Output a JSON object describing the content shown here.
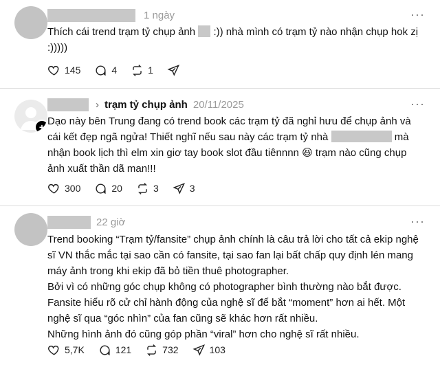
{
  "posts": [
    {
      "time": "1 ngày",
      "text_before": "Thích cái trend trạm tỷ chụp ảnh",
      "text_after": ":)) nhà mình có trạm tỷ nào nhận chụp hok zị :)))))",
      "likes": "145",
      "comments": "4",
      "reposts": "1",
      "shares": ""
    },
    {
      "group": "trạm tỷ chụp ảnh",
      "time": "20/11/2025",
      "text_before": "Dạo này bên Trung đang có trend book các trạm tỷ đã nghỉ hưu để chụp ảnh và cái kết đẹp ngã ngửa! Thiết nghĩ nếu sau này các trạm tỷ nhà",
      "text_after": "mà nhận book lịch thì elm xin giơ tay book slot đầu tiênnnn 😆 trạm nào cũng chụp ảnh xuất thần dã man!!!",
      "likes": "300",
      "comments": "20",
      "reposts": "3",
      "shares": "3"
    },
    {
      "time": "22 giờ",
      "lines": [
        "Trend booking “Trạm tỷ/fansite” chụp ảnh chính là câu trả lời cho tất cả ekip nghệ sĩ VN thắc mắc tại sao cần có fansite, tại sao fan lại bất chấp quy định lén mang máy ảnh trong khi ekip đã bỏ tiền thuê photographer.",
        "Bởi vì có những góc chụp không có photographer bình thường nào bắt được.",
        "Fansite hiểu rõ cử chỉ hành động của nghệ sĩ để bắt “moment” hơn ai hết. Một nghệ sĩ qua “góc nhìn” của fan cũng sẽ khác hơn rất nhiều.",
        "Những hình ảnh đó cũng góp phần “viral” hơn cho nghệ sĩ rất nhiều."
      ],
      "likes": "5,7K",
      "comments": "121",
      "reposts": "732",
      "shares": "103"
    }
  ],
  "icons": [
    "heart-icon",
    "comment-icon",
    "repost-icon",
    "share-icon",
    "more-icon",
    "follow-plus-icon"
  ],
  "colors": {
    "redaction": "#c8c8c8",
    "time": "#9a9a9a",
    "divider": "#dedede"
  }
}
